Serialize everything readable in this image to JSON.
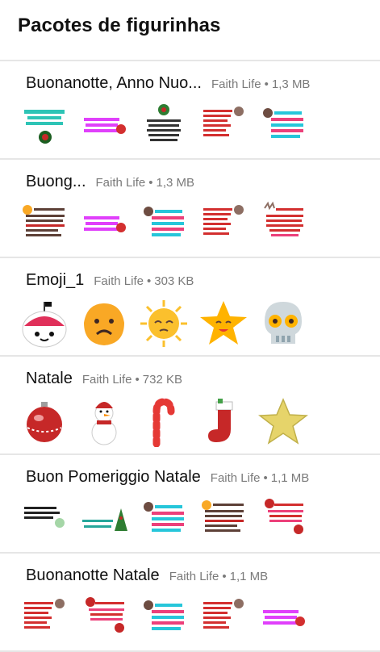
{
  "header": {
    "title": "Pacotes de figurinhas"
  },
  "packs": [
    {
      "name": "Buonanotte, Anno Nuo...",
      "author": "Faith Life",
      "size": "1,3 MB",
      "stickers": [
        "text-sticker-green",
        "text-sticker-pink",
        "text-sticker-wreath",
        "text-sticker-red",
        "text-sticker-teal"
      ]
    },
    {
      "name": "Buong...",
      "author": "Faith Life",
      "size": "1,3 MB",
      "stickers": [
        "text-sticker-gold",
        "text-sticker-pink",
        "text-sticker-teal",
        "text-sticker-red",
        "text-sticker-reindeer"
      ]
    },
    {
      "name": "Emoji_1",
      "author": "Faith Life",
      "size": "303 KB",
      "stickers": [
        "sushi-emoji",
        "worried-emoji",
        "sun-emoji",
        "star-emoji",
        "skull-emoji"
      ]
    },
    {
      "name": "Natale",
      "author": "Faith Life",
      "size": "732 KB",
      "stickers": [
        "ornament-ball",
        "snowman",
        "candy-cane",
        "stocking",
        "gold-star"
      ]
    },
    {
      "name": "Buon Pomeriggio Natale",
      "author": "Faith Life",
      "size": "1,1 MB",
      "stickers": [
        "text-sticker-black",
        "text-sticker-tree",
        "text-sticker-teal",
        "text-sticker-gold",
        "text-sticker-santa"
      ]
    },
    {
      "name": "Buonanotte Natale",
      "author": "Faith Life",
      "size": "1,1 MB",
      "stickers": [
        "text-sticker-red",
        "text-sticker-santa",
        "text-sticker-teal",
        "text-sticker-red",
        "text-sticker-pink"
      ]
    }
  ],
  "meta_separator": "•",
  "colors": {
    "divider": "#e6e6e6",
    "meta": "#7a7a7a",
    "title": "#111111"
  }
}
